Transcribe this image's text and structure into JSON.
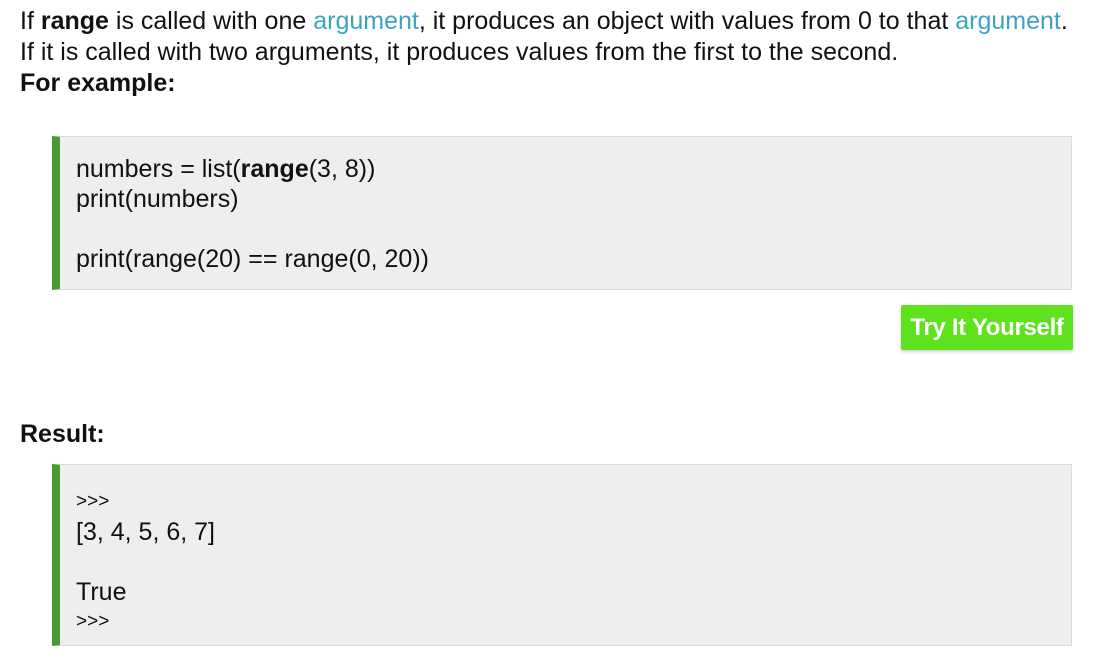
{
  "intro": {
    "line1": {
      "prefix": "If ",
      "keyword": "range",
      "middle": " is called with one ",
      "link1": "argument",
      "after_link1": ", it produces an object with values from 0 to that ",
      "link2": "argument",
      "suffix": "."
    },
    "line2": "If it is called with two arguments, it produces values from the first to the second.",
    "example_label": "For example:"
  },
  "example_code": {
    "line1_before": "numbers = list(",
    "line1_keyword": "range",
    "line1_after": "(3, 8))",
    "line2": "print(numbers)",
    "line3": "print(range(20) == range(0, 20))"
  },
  "try_button": {
    "label": "Try It Yourself"
  },
  "result": {
    "label": "Result:",
    "prompt_start": ">>>",
    "output1": "[3, 4, 5, 6, 7]",
    "output2": "True",
    "prompt_end": ">>>"
  },
  "colors": {
    "link": "#3ba4c6",
    "code_border_accent": "#4a9a34",
    "code_background": "#eceef0",
    "button_background": "#5ee21e",
    "button_text": "#ffffff"
  }
}
